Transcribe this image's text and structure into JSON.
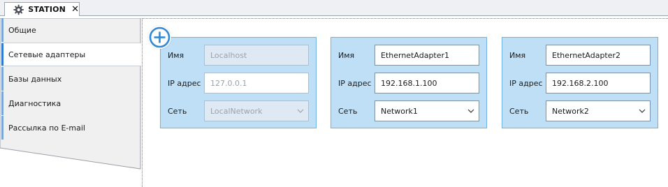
{
  "tab": {
    "title": "STATION",
    "close": "✕",
    "icon": "gear-icon"
  },
  "sidebar": {
    "items": [
      {
        "label": "Общие",
        "active": false
      },
      {
        "label": "Сетевые адаптеры",
        "active": true
      },
      {
        "label": "Базы данных",
        "active": false
      },
      {
        "label": "Диагностика",
        "active": false
      },
      {
        "label": "Рассылка по E-mail",
        "active": false
      }
    ]
  },
  "add_button": {
    "icon": "plus-circle-icon",
    "color": "#2f88d8"
  },
  "adapters": [
    {
      "name_label": "Имя",
      "name": "Localhost",
      "ip_label": "IP адрес",
      "ip": "127.0.0.1",
      "net_label": "Сеть",
      "network": "LocalNetwork",
      "disabled": true
    },
    {
      "name_label": "Имя",
      "name": "EthernetAdapter1",
      "ip_label": "IP адрес",
      "ip": "192.168.1.100",
      "net_label": "Сеть",
      "network": "Network1",
      "disabled": false
    },
    {
      "name_label": "Имя",
      "name": "EthernetAdapter2",
      "ip_label": "IP адрес",
      "ip": "192.168.2.100",
      "net_label": "Сеть",
      "network": "Network2",
      "disabled": false
    }
  ],
  "colors": {
    "card_bg": "#bfdff7",
    "card_border": "#6fb3e6",
    "accent": "#2f7bd0"
  }
}
